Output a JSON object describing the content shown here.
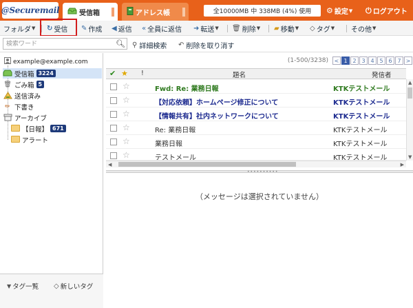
{
  "header": {
    "logo": "@Securemail",
    "tabs": [
      {
        "label": "受信箱",
        "icon": "inbox-icon"
      },
      {
        "label": "アドレス帳",
        "icon": "address-book-icon"
      }
    ],
    "usage": "全10000MB 中 338MB (4%) 使用",
    "usage_percent": 4,
    "settings_label": "設定",
    "logout_label": "ログアウト",
    "colors": {
      "bar": "#e8611a",
      "highlight": "#d21c1c",
      "selected": "#d4e4f7"
    }
  },
  "toolbar": {
    "folder": "フォルダ",
    "receive": "受信",
    "compose": "作成",
    "reply": "返信",
    "reply_all": "全員に返信",
    "forward": "転送",
    "delete": "削除",
    "move": "移動",
    "tag": "タグ",
    "other": "その他"
  },
  "search": {
    "placeholder": "検索ワード",
    "advanced": "詳細検索",
    "clear": "削除を取り消す"
  },
  "sidebar": {
    "account": "example@example.com",
    "folders": [
      {
        "label": "受信箱",
        "badge": "3224",
        "icon": "inbox-icon"
      },
      {
        "label": "ごみ箱",
        "badge": "5",
        "icon": "trash-icon"
      },
      {
        "label": "送信済み",
        "badge": "",
        "icon": "sent-icon"
      },
      {
        "label": "下書き",
        "badge": "",
        "icon": "draft-icon"
      },
      {
        "label": "アーカイブ",
        "badge": "",
        "icon": "archive-icon"
      },
      {
        "label": "【日報】",
        "badge": "671",
        "icon": "folder-icon"
      },
      {
        "label": "アラート",
        "badge": "",
        "icon": "folder-icon"
      }
    ],
    "footer": {
      "tag_list": "タグ一覧",
      "new_tag": "新しいタグ"
    }
  },
  "list": {
    "range": "(1-500/3238)",
    "pages": [
      "1",
      "2",
      "3",
      "4",
      "5",
      "6",
      "7"
    ],
    "headers": {
      "exclaim": "!",
      "subject": "題名",
      "from": "発信者"
    },
    "rows": [
      {
        "subject": "Fwd: Re: 業務日報",
        "from": "KTKテストメール",
        "style": "green"
      },
      {
        "subject": "【対応依頼】ホームページ修正について",
        "from": "KTKテストメール",
        "style": "unread"
      },
      {
        "subject": "【情報共有】社内ネットワークについて",
        "from": "KTKテストメール",
        "style": "unread"
      },
      {
        "subject": "Re: 業務日報",
        "from": "KTKテストメール",
        "style": "read"
      },
      {
        "subject": "業務日報",
        "from": "KTKテストメール",
        "style": "read"
      },
      {
        "subject": "テストメール",
        "from": "KTKテストメール",
        "style": "read"
      }
    ]
  },
  "preview": {
    "empty_text": "（メッセージは選択されていません）"
  }
}
